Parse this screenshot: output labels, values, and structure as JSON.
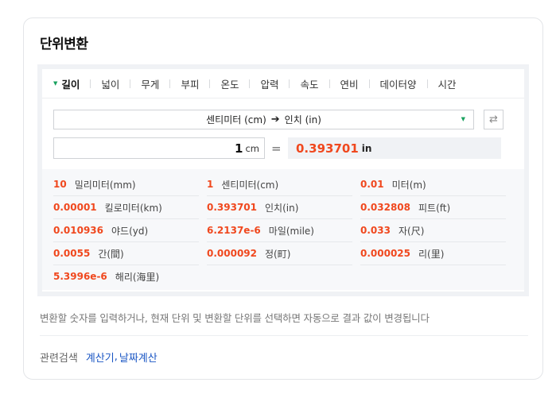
{
  "title": "단위변환",
  "tabs": [
    {
      "label": "길이",
      "active": true
    },
    {
      "label": "넓이",
      "active": false
    },
    {
      "label": "무게",
      "active": false
    },
    {
      "label": "부피",
      "active": false
    },
    {
      "label": "온도",
      "active": false
    },
    {
      "label": "압력",
      "active": false
    },
    {
      "label": "속도",
      "active": false
    },
    {
      "label": "연비",
      "active": false
    },
    {
      "label": "데이터양",
      "active": false
    },
    {
      "label": "시간",
      "active": false
    }
  ],
  "selector": {
    "from_unit": "센티미터 (cm)",
    "arrow": "➔",
    "to_unit": "인치 (in)"
  },
  "swap_icon": "⇄",
  "input": {
    "value": "1",
    "unit": "cm"
  },
  "equals": "=",
  "result": {
    "value": "0.393701",
    "unit": "in"
  },
  "conversions": [
    {
      "value": "10",
      "name": "밀리미터(mm)"
    },
    {
      "value": "1",
      "name": "센티미터(cm)"
    },
    {
      "value": "0.01",
      "name": "미터(m)"
    },
    {
      "value": "0.00001",
      "name": "킬로미터(km)"
    },
    {
      "value": "0.393701",
      "name": "인치(in)"
    },
    {
      "value": "0.032808",
      "name": "피트(ft)"
    },
    {
      "value": "0.010936",
      "name": "야드(yd)"
    },
    {
      "value": "6.2137e-6",
      "name": "마일(mile)"
    },
    {
      "value": "0.033",
      "name": "자(尺)"
    },
    {
      "value": "0.0055",
      "name": "간(間)"
    },
    {
      "value": "0.000092",
      "name": "정(町)"
    },
    {
      "value": "0.000025",
      "name": "리(里)"
    },
    {
      "value": "5.3996e-6",
      "name": "해리(海里)"
    }
  ],
  "description": "변환할 숫자를 입력하거나, 현재 단위 및 변환할 단위를 선택하면 자동으로 결과 값이 변경됩니다",
  "related": {
    "label": "관련검색",
    "links": [
      "계산기",
      "날짜계산"
    ],
    "separator": ","
  },
  "colors": {
    "accent_value": "#f0481e",
    "tab_marker": "#19a15e",
    "link": "#1a56c4"
  }
}
